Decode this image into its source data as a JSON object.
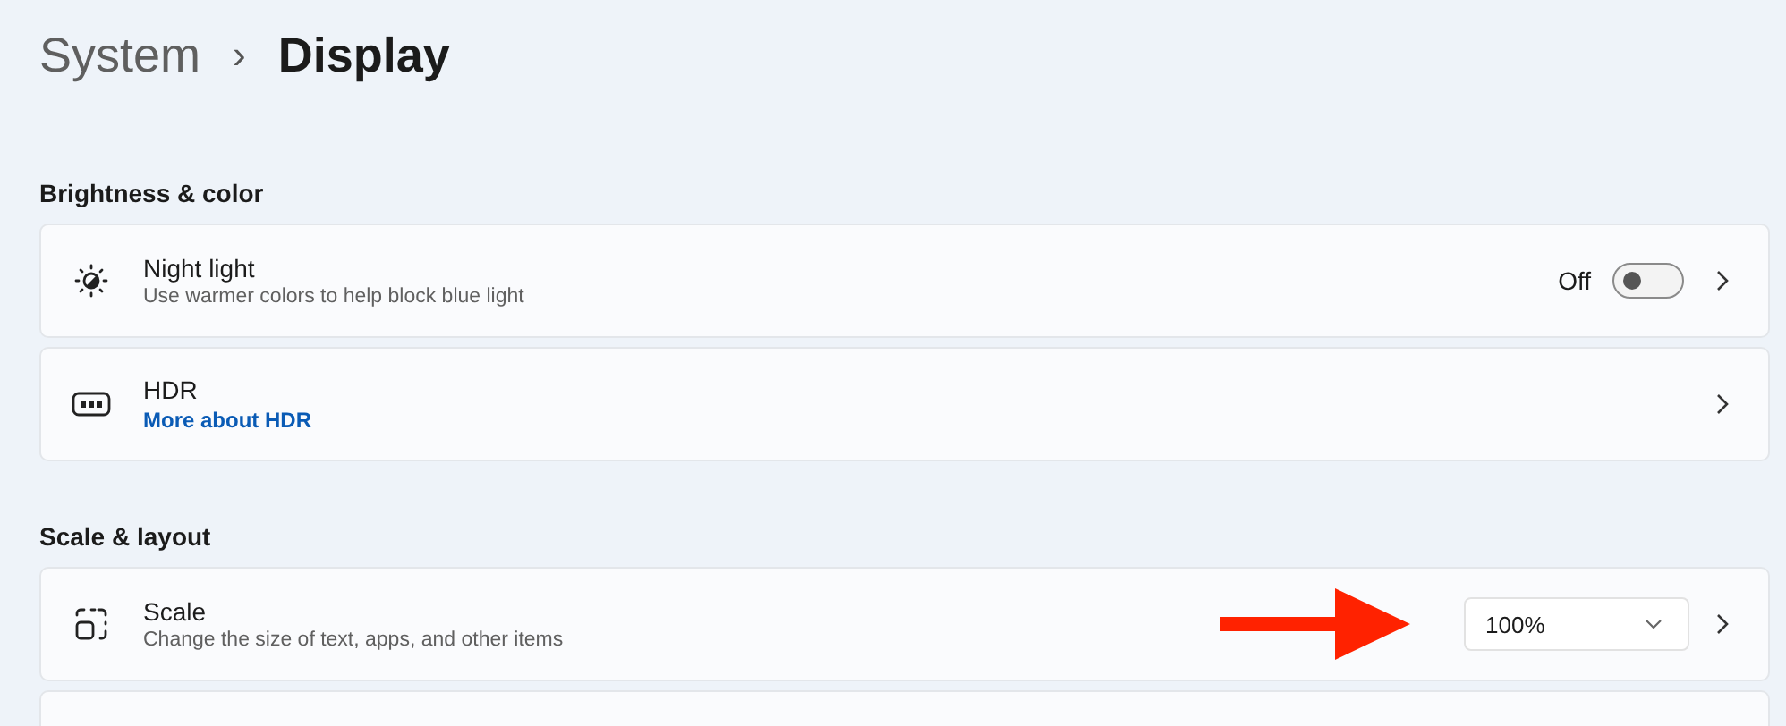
{
  "breadcrumb": {
    "parent": "System",
    "separator": "›",
    "current": "Display"
  },
  "sections": [
    {
      "heading": "Brightness & color",
      "items": [
        {
          "kind": "toggle",
          "title": "Night light",
          "subtitle": "Use warmer colors to help block blue light",
          "state_label": "Off",
          "on": false
        },
        {
          "kind": "link",
          "title": "HDR",
          "link": "More about HDR"
        }
      ]
    },
    {
      "heading": "Scale & layout",
      "items": [
        {
          "kind": "dropdown",
          "title": "Scale",
          "subtitle": "Change the size of text, apps, and other items",
          "value": "100%"
        },
        {
          "kind": "empty"
        }
      ]
    }
  ]
}
